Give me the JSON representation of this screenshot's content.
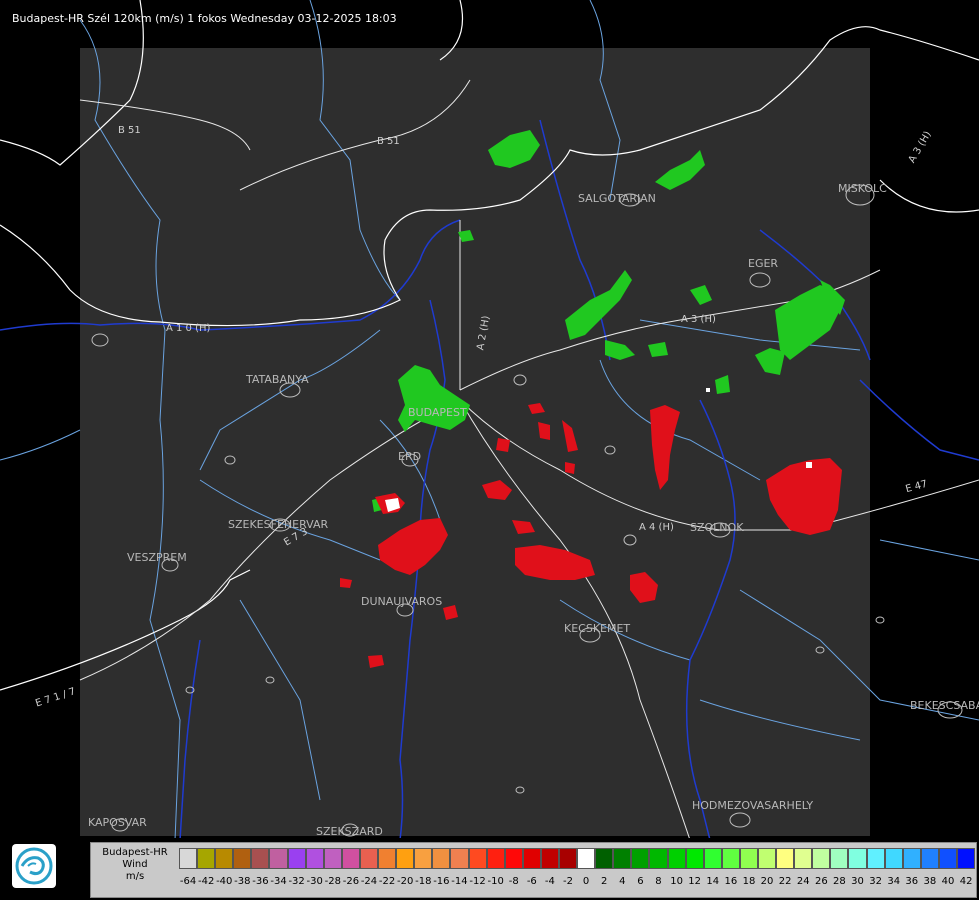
{
  "header": {
    "title": "Budapest-HR Szél 120km (m/s) 1 fokos Wednesday 03-12-2025 18:03"
  },
  "map": {
    "cities": [
      "SALGOTARJAN",
      "MISKOLC",
      "EGER",
      "TATABANYA",
      "BUDAPEST",
      "ERD",
      "SZEKESFEHERVAR",
      "VESZPREM",
      "DUNAUJVAROS",
      "KECSKEMET",
      "SZOLNOK",
      "BEKESCSABA",
      "HODMEZOVASARHELY",
      "KAPOSVAR",
      "SZEKSZARD"
    ],
    "roads": [
      "B 51",
      "B 51",
      "A 3 (H)",
      "A 3 (H)",
      "A 1 0 (H)",
      "A 2 (H)",
      "A 4 (H)",
      "E 47",
      "E 7 1 / 7",
      "E 7 3"
    ],
    "colors": {
      "background": "#000000",
      "radar_area": "#2e2e2e",
      "rivers": "#1f3bd0",
      "borders": "#ffffff",
      "county_lines": "#6aa3e0",
      "approaching": "#e0101a",
      "receding": "#20c820"
    }
  },
  "legend": {
    "title_lines": [
      "Budapest-HR",
      "Wind",
      "m/s"
    ],
    "ticks": [
      "-64",
      "-42",
      "-40",
      "-38",
      "-36",
      "-34",
      "-32",
      "-30",
      "-28",
      "-26",
      "-24",
      "-22",
      "-20",
      "-18",
      "-16",
      "-14",
      "-12",
      "-10",
      "-8",
      "-6",
      "-4",
      "-2",
      "0",
      "2",
      "4",
      "6",
      "8",
      "10",
      "12",
      "14",
      "16",
      "18",
      "20",
      "22",
      "24",
      "26",
      "28",
      "30",
      "32",
      "34",
      "36",
      "38",
      "40",
      "42"
    ],
    "colors": [
      "#d8d8d8",
      "#a6a600",
      "#b88a00",
      "#b06010",
      "#a85050",
      "#c060a0",
      "#9a40f0",
      "#b050e0",
      "#c060c0",
      "#d050a0",
      "#e86050",
      "#f08030",
      "#ffa010",
      "#f8a040",
      "#f09040",
      "#ef8050",
      "#ff4a20",
      "#ff2010",
      "#ff0808",
      "#e00000",
      "#c00000",
      "#a80000",
      "#ffffff",
      "#006000",
      "#008000",
      "#00a000",
      "#00b800",
      "#00d000",
      "#00e800",
      "#30ff30",
      "#60ff40",
      "#90ff50",
      "#c0ff70",
      "#ffff80",
      "#e0ff90",
      "#c0ffa0",
      "#a0ffc0",
      "#80ffe0",
      "#60f0ff",
      "#40d8ff",
      "#30b0ff",
      "#2080ff",
      "#1050ff",
      "#0010ff"
    ]
  }
}
